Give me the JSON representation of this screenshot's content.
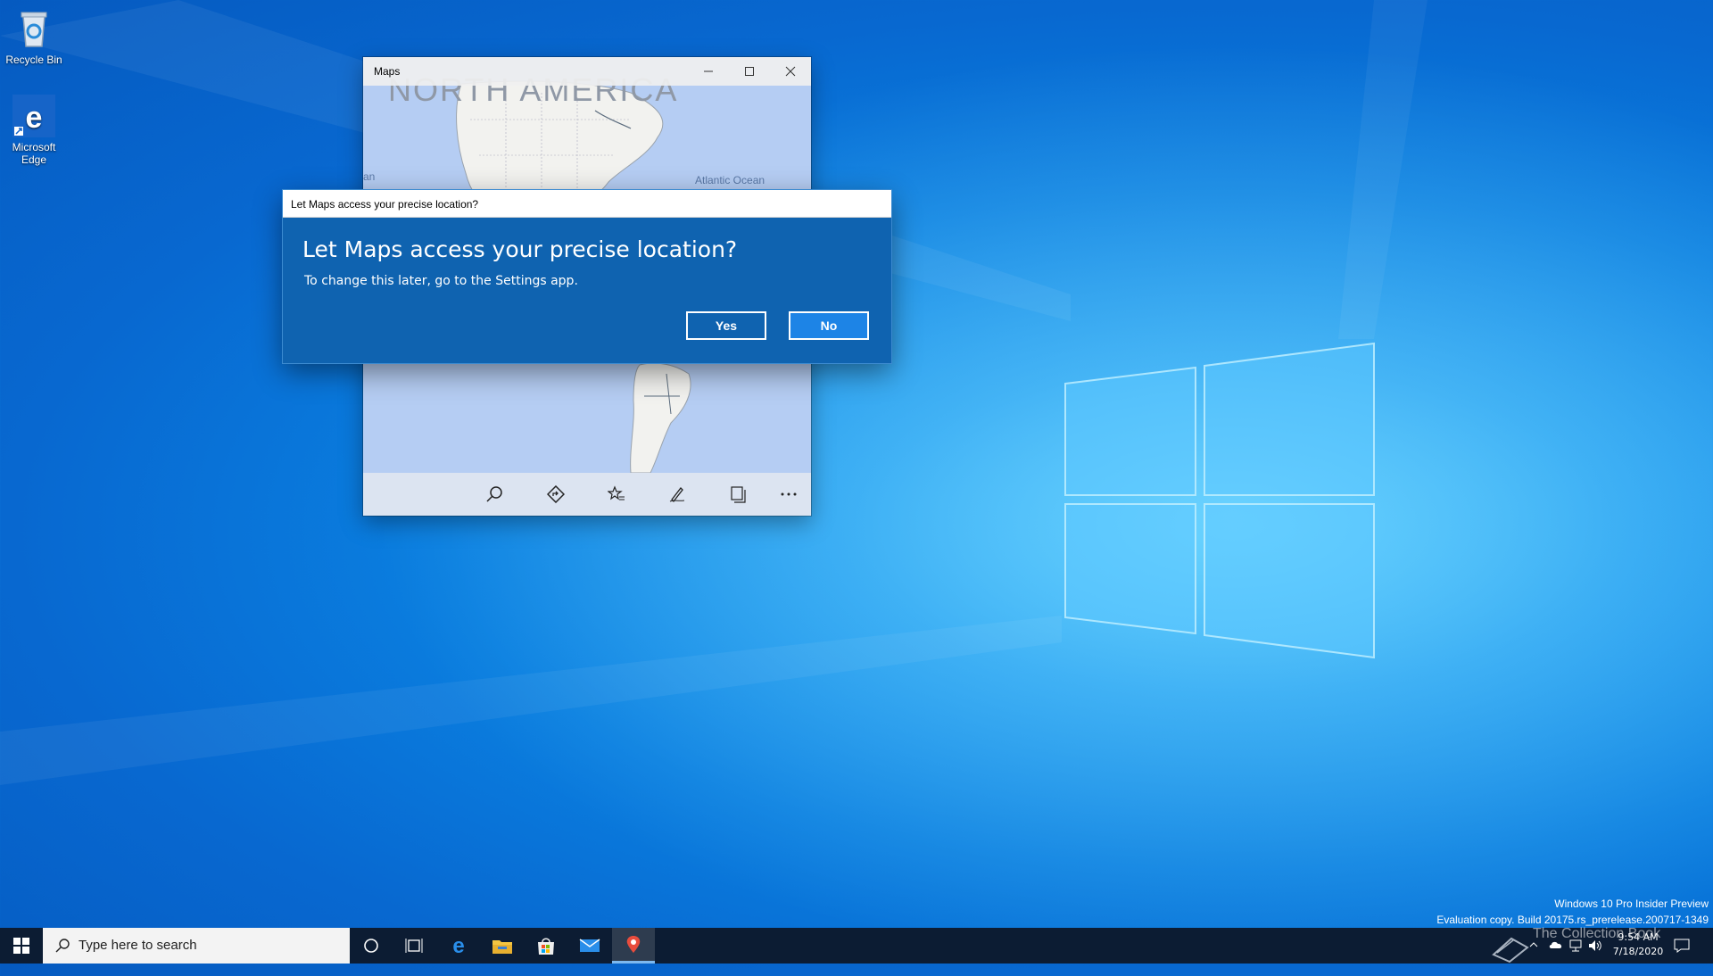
{
  "desktop": {
    "icons": [
      {
        "label": "Recycle Bin"
      },
      {
        "label": "Microsoft Edge"
      }
    ]
  },
  "maps_window": {
    "title": "Maps",
    "map_labels": {
      "continent": "NORTH AMERICA",
      "ocean": "Atlantic Ocean",
      "partial": "an"
    },
    "toolbar_icons": [
      "search-icon",
      "directions-icon",
      "favorites-icon",
      "ink-icon",
      "collections-icon",
      "more-icon"
    ]
  },
  "dialog": {
    "title": "Let Maps access your precise location?",
    "heading": "Let Maps access your precise location?",
    "subtext": "To change this later, go to the Settings app.",
    "yes_label": "Yes",
    "no_label": "No",
    "colors": {
      "background": "#0f63b0",
      "button_accent": "#1d84e6"
    }
  },
  "watermark": {
    "line1": "Windows 10 Pro Insider Preview",
    "line2": "Evaluation copy. Build 20175.rs_prerelease.200717-1349"
  },
  "overlay_logo_text": "The Collection Book",
  "taskbar": {
    "search_placeholder": "Type here to search",
    "pinned": [
      "cortana-icon",
      "task-view-icon",
      "edge-icon",
      "file-explorer-icon",
      "store-icon",
      "mail-icon",
      "maps-icon"
    ],
    "clock": {
      "time": "9:54 AM",
      "date": "7/18/2020"
    }
  }
}
